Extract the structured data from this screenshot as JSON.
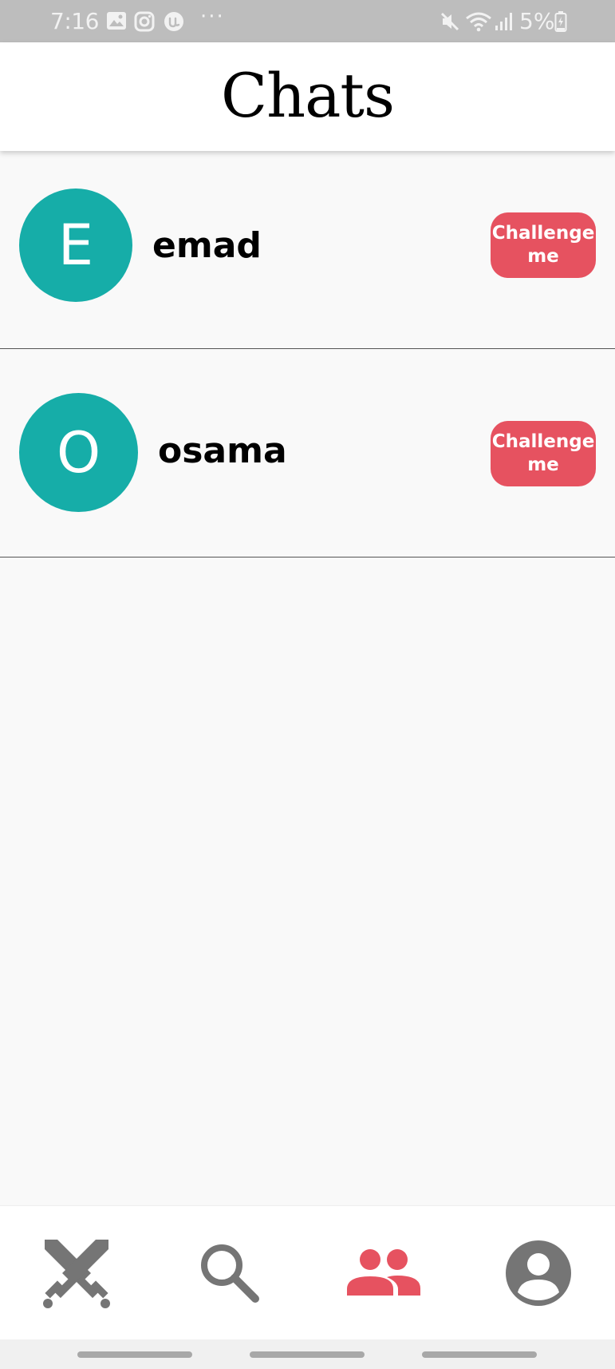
{
  "status_bar": {
    "time": "7:16",
    "battery": "5%",
    "overflow": "···",
    "icons": [
      "gallery-icon",
      "instagram-icon",
      "app-notification-icon",
      "mute-icon",
      "wifi-icon",
      "signal-icon",
      "battery-icon"
    ]
  },
  "header": {
    "title": "Chats"
  },
  "chats": [
    {
      "initial": "E",
      "name": "emad",
      "action": "Challenge me"
    },
    {
      "initial": "O",
      "name": "osama",
      "action": "Challenge me"
    }
  ],
  "bottom_nav": {
    "items": [
      {
        "icon": "crossed-swords-icon",
        "active": false
      },
      {
        "icon": "search-icon",
        "active": false
      },
      {
        "icon": "people-icon",
        "active": true
      },
      {
        "icon": "account-circle-icon",
        "active": false
      }
    ]
  },
  "colors": {
    "accent": "#e65260",
    "avatar": "#16ada8",
    "inactive_icon": "#757575",
    "status_bar": "#bdbdbd"
  }
}
